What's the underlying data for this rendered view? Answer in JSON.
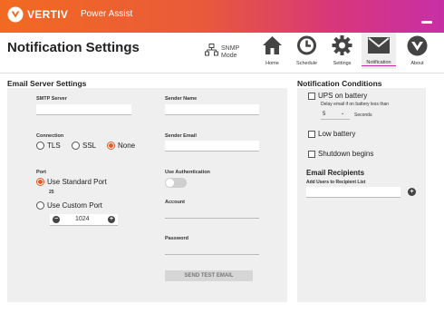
{
  "app": {
    "brand": "VERTIV",
    "product": "Power Assist"
  },
  "header": {
    "title": "Notification Settings",
    "snmp_label": "SNMP Mode"
  },
  "nav": [
    {
      "label": "Home",
      "icon": "home-icon"
    },
    {
      "label": "Schedule",
      "icon": "clock-icon"
    },
    {
      "label": "Settings",
      "icon": "gear-icon"
    },
    {
      "label": "Notification",
      "icon": "envelope-icon"
    },
    {
      "label": "About",
      "icon": "vertiv-logo-icon"
    }
  ],
  "email_server": {
    "title": "Email Server Settings",
    "smtp_label": "SMTP Server",
    "smtp_value": "",
    "sender_name_label": "Sender Name",
    "sender_name_value": "",
    "connection_label": "Connection",
    "connection_options": [
      "TLS",
      "SSL",
      "None"
    ],
    "connection_selected": "None",
    "sender_email_label": "Sender Email",
    "sender_email_value": "",
    "port_label": "Port",
    "standard_port_label": "Use Standard Port",
    "standard_port_value": "25",
    "custom_port_label": "Use Custom Port",
    "custom_port_value": "1024",
    "use_auth_label": "Use Authentication",
    "account_label": "Account",
    "account_value": "",
    "password_label": "Password",
    "password_value": "",
    "send_test_label": "SEND TEST EMAIL"
  },
  "notification_conditions": {
    "title": "Notification Conditions",
    "ups_on_battery": "UPS on battery",
    "delay_text": "Delay email if on battery less than",
    "delay_value": "5",
    "delay_unit": "Seconds",
    "low_battery": "Low battery",
    "shutdown_begins": "Shutdown begins"
  },
  "recipients": {
    "title": "Email Recipients",
    "add_label": "Add Users to Recipient List",
    "add_value": ""
  },
  "colors": {
    "accent": "#e25a2b",
    "gradient_start": "#f26a21",
    "gradient_end": "#c72fa7"
  }
}
